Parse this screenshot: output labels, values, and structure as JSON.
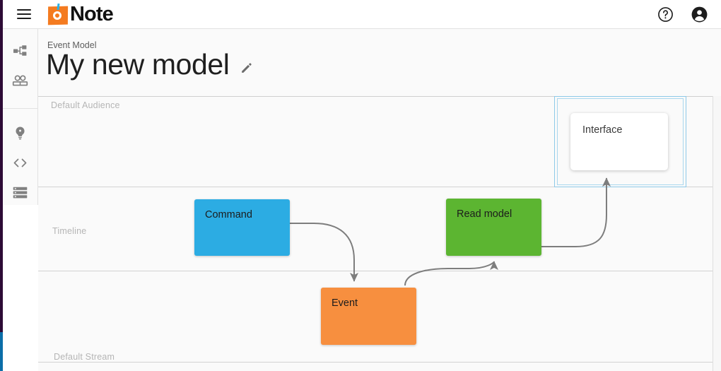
{
  "app": {
    "brand_name": "Note",
    "logo_colors": {
      "square": "#f47b20",
      "tick": "#29b2e8"
    }
  },
  "topbar": {
    "menu_icon": "hamburger-menu-icon",
    "help_icon": "help-circle-icon",
    "account_icon": "account-circle-icon"
  },
  "sidebar": {
    "items": [
      {
        "name": "account-tree",
        "icon": "account-tree-icon"
      },
      {
        "name": "audiences",
        "icon": "people-group-icon"
      },
      {
        "name": "ideas",
        "icon": "lightbulb-icon"
      },
      {
        "name": "code",
        "icon": "code-brackets-icon"
      },
      {
        "name": "streams",
        "icon": "storage-list-icon"
      }
    ]
  },
  "header": {
    "breadcrumb": "Event Model",
    "title": "My new model",
    "edit_icon": "pencil-edit-icon"
  },
  "canvas": {
    "lanes": [
      {
        "label": "Default Audience",
        "label_pos": "top"
      },
      {
        "label": "Timeline",
        "label_pos": "middle"
      },
      {
        "label": "Default Stream",
        "label_pos": "bottom"
      }
    ],
    "cards": [
      {
        "label": "Command",
        "type": "command",
        "color": "#2cace3"
      },
      {
        "label": "Read model",
        "type": "read-model",
        "color": "#5cb531"
      },
      {
        "label": "Event",
        "type": "event",
        "color": "#f78f3f"
      },
      {
        "label": "Interface",
        "type": "interface",
        "color": "#ffffff"
      }
    ],
    "selection": {
      "target": "Interface",
      "border_color": "#8ec9e8"
    },
    "connectors": [
      {
        "from": "Command",
        "to": "Event"
      },
      {
        "from": "Event",
        "to": "Read model"
      },
      {
        "from": "Read model",
        "to": "Interface"
      }
    ]
  }
}
